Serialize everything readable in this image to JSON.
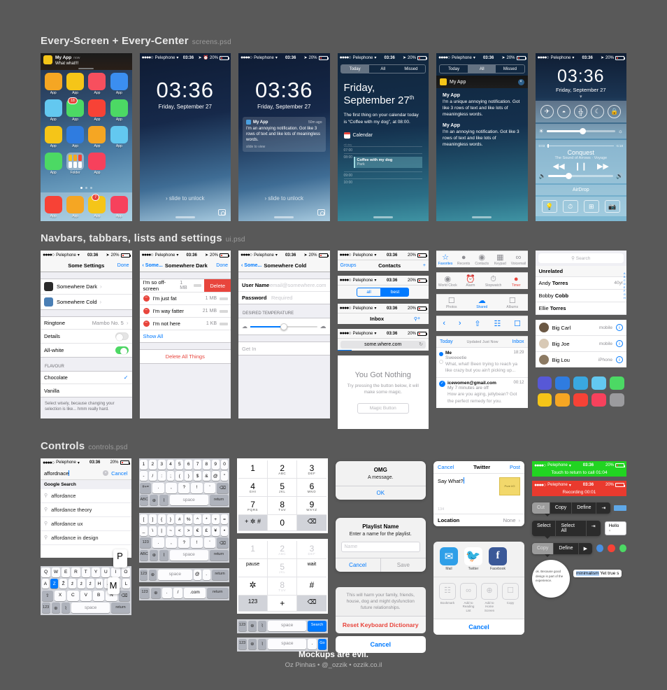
{
  "sections": [
    {
      "title": "Every-Screen + Every-Center",
      "file": "screens.psd"
    },
    {
      "title": "Navbars, tabbars, lists and settings",
      "file": "ui.psd"
    },
    {
      "title": "Controls",
      "file": "controls.psd"
    }
  ],
  "status_bar": {
    "carrier": "Pelephone",
    "time": "03:36",
    "battery": "20%",
    "dots": "●●●●○"
  },
  "home": {
    "banner": {
      "app": "My App",
      "time": "now",
      "message": "What what!!!"
    },
    "app_label": "App",
    "folder_label": "Folder",
    "badges": {
      "grid": "18",
      "dock": "7"
    },
    "rows": [
      [
        "#f5a623",
        "#f5c518",
        "#f74f5e",
        "#3b8ef0"
      ],
      [
        "#63c8f0",
        "#4cd964",
        "#f74236",
        "#4cd964"
      ],
      [
        "#f5c518",
        "#2f7ce0",
        "#f5a623",
        "#63c8f0"
      ],
      [
        "#4cd964",
        "folder",
        "#f7415c",
        ""
      ]
    ],
    "dock": [
      "#f74236",
      "#f5a623",
      "#f5c518",
      "#f7415c"
    ]
  },
  "lock": {
    "time": "03:36",
    "date": "Friday, September 27",
    "slide": "›  slide to unlock",
    "notification": {
      "app": "My App",
      "when": "50m ago",
      "title": "I'm an annoying notification. Got like 3 rows of text and like lots of meaningless words.",
      "hint": "slide to view"
    }
  },
  "notification_center": {
    "tabs": [
      "Today",
      "All",
      "Missed"
    ],
    "today": {
      "active_tab": "Today",
      "heading_line1": "Friday,",
      "heading_line2": "September 27",
      "heading_sup": "th",
      "summary": "The first thing on your calendar today is “Coffee with my dog”, at 08:00.",
      "calendar_label": "Calendar",
      "all_day": "all-day",
      "hours": [
        "07:00",
        "08:00",
        "09:00",
        "10:00"
      ],
      "event_title": "Coffee with my dog",
      "event_place": "Park"
    },
    "all": {
      "active_tab": "All",
      "app_header": "My App",
      "items": [
        {
          "app": "My App",
          "text": "I'm a unique annoying notification. Got like 3 rows of text and like lots of meaningless words."
        },
        {
          "app": "My App",
          "text": "I'm an annoying notification. Got like 3 rows of text and like lots of meaningless words."
        }
      ]
    }
  },
  "control_center": {
    "time": "03:36",
    "date": "Friday, September 27",
    "toggles": [
      "airplane-mode",
      "wifi",
      "bluetooth",
      "do-not-disturb",
      "rotation-lock"
    ],
    "brightness": 52,
    "now_playing": {
      "title": "Conquest",
      "subtitle": "The Sound of Arrows · Voyage",
      "elapsed": "0:03",
      "remaining": "-5:18"
    },
    "volume": 30,
    "airdrop": "AirDrop",
    "quick": [
      "flashlight",
      "timer",
      "calculator",
      "camera"
    ]
  },
  "settings": {
    "title": "Some Settings",
    "done": "Done",
    "rows": [
      {
        "label": "Somewhere Dark",
        "icon": "#2b2b2b"
      },
      {
        "label": "Somewhere Cold",
        "icon": "#4a7fb5"
      }
    ],
    "ringtone": {
      "label": "Ringtone",
      "value": "Mambo No. 5"
    },
    "details": {
      "label": "Details",
      "on": false
    },
    "allwhite": {
      "label": "All-white",
      "on": true
    },
    "flavour_header": "FLAVOUR",
    "flavours": [
      {
        "label": "Chocolate",
        "checked": true
      },
      {
        "label": "Vanilla",
        "checked": false
      }
    ],
    "footer": "Select wisely, because changing your selection is like... hmm really hard."
  },
  "dark": {
    "back": "Some...",
    "title": "Somewhere Dark",
    "done": "Done",
    "swipe_row": {
      "label": "I'm so off-screen",
      "size": "1 MB",
      "delete": "Delete"
    },
    "rows": [
      {
        "label": "I'm just fat",
        "size": "1 MB"
      },
      {
        "label": "I'm way fatter",
        "size": "21 MB"
      },
      {
        "label": "I'm not here",
        "size": "1 KB"
      }
    ],
    "show_all": "Show All",
    "delete_all": "Delete All Things"
  },
  "cold": {
    "back": "Some...",
    "title": "Somewhere Cold",
    "username": {
      "label": "User Name",
      "placeholder": "email@somewhere.com"
    },
    "password": {
      "label": "Password",
      "placeholder": "Required"
    },
    "temp_header": "DESIRED TEMPERATURE",
    "get_in": "Get In"
  },
  "bars": {
    "contacts": {
      "left": "Groups",
      "title": "Contacts",
      "right": "+"
    },
    "segment": {
      "options": [
        "all",
        "best"
      ],
      "selected": "best"
    },
    "inbox": {
      "title": "Inbox",
      "search": "search-icon",
      "add": "+"
    },
    "browser": {
      "url": "some.where.com",
      "reload": "↻"
    },
    "empty": {
      "title": "You Got Nothing",
      "body": "Try pressing the button below, it will make some magic.",
      "button": "Magic Button"
    }
  },
  "tabbars": {
    "phone": [
      {
        "label": "Favorites",
        "icon": "star",
        "on": true
      },
      {
        "label": "Recents",
        "icon": "clock",
        "on": false
      },
      {
        "label": "Contacts",
        "icon": "person",
        "on": false
      },
      {
        "label": "Keypad",
        "icon": "grid",
        "on": false
      },
      {
        "label": "Voicemail",
        "icon": "tape",
        "on": false
      }
    ],
    "clock": [
      {
        "label": "World Clock",
        "icon": "globe",
        "on": false
      },
      {
        "label": "Alarm",
        "icon": "alarm",
        "on": false
      },
      {
        "label": "Stopwatch",
        "icon": "stopwatch",
        "on": false
      },
      {
        "label": "Timer",
        "icon": "timer",
        "red": true
      }
    ],
    "photos": [
      {
        "label": "Photos",
        "icon": "photos",
        "on": false
      },
      {
        "label": "Shared",
        "icon": "cloud",
        "on": true
      },
      {
        "label": "Albums",
        "icon": "albums",
        "on": false
      }
    ],
    "safari": [
      "back",
      "forward",
      "share",
      "bookmarks",
      "tabs"
    ]
  },
  "mail": {
    "header": {
      "left": "Today",
      "middle": "Updated Just Now",
      "right": "Inbox"
    },
    "messages": [
      {
        "from": "Me",
        "time": "18:29",
        "subject": "Sweeeetie",
        "preview": "What, what! Been trying to reach ya like crazy but you ain't picking up...",
        "unread": true,
        "checked": false
      },
      {
        "from": "icewomen@gmail.com",
        "time": "00:12",
        "subject": "My 7 minutes are off",
        "preview": "How are you aging, jellybean? Got the perfect remedy for you.",
        "unread": false,
        "checked": true
      }
    ]
  },
  "contacts": {
    "search_placeholder": "Search",
    "section": "Unrelated",
    "index": [
      "A",
      "B",
      "C",
      "D",
      "E",
      "F",
      "G",
      "H"
    ],
    "people": [
      {
        "name_first": "Andy",
        "name_last": "Torres",
        "meta": "40yr"
      },
      {
        "name_first": "Bobby",
        "name_last": "Cobb",
        "meta": ""
      },
      {
        "name_first": "Ellie",
        "name_last": "Torres",
        "meta": ""
      }
    ],
    "calls": [
      {
        "name": "Big Carl",
        "kind": "mobile"
      },
      {
        "name": "Big Joe",
        "kind": "mobile"
      },
      {
        "name": "Big Lou",
        "kind": "iPhone"
      }
    ],
    "swatches": [
      "#5758d6",
      "#2f7ce0",
      "#3aa8e0",
      "#63c8f0",
      "#4cd964",
      "#f5c518",
      "#f5a623",
      "#f74236",
      "#f7415c",
      "#9b9b9e"
    ]
  },
  "controls": {
    "search": {
      "value": "affordnace",
      "cancel": "Cancel",
      "group": "Google Search",
      "suggestions": [
        "affordance",
        "affordance theory",
        "affordance ux",
        "affordance in design"
      ]
    },
    "keyboard_letters": {
      "row1": [
        "Q",
        "W",
        "E",
        "R",
        "T",
        "Y",
        "U",
        "I",
        "O",
        "P"
      ],
      "row2": [
        "A",
        "Z",
        "Ž",
        "ź",
        "ż",
        "ź",
        "H",
        "J",
        "K",
        "L"
      ],
      "row3": [
        "X",
        "C",
        "V",
        "B",
        "N",
        "M"
      ],
      "shift": "⇧",
      "backspace": "⌫",
      "num": "123",
      "globe": "⊕",
      "mic": "⌇",
      "space": "space",
      "return": "return",
      "popup": "P",
      "selected_key": "Z",
      "big_key": "M"
    },
    "keyboard_numbers": {
      "row1": [
        "1",
        "2",
        "3",
        "4",
        "5",
        "6",
        "7",
        "8",
        "9",
        "0"
      ],
      "row2": [
        "-",
        "/",
        ":",
        ";",
        "(",
        ")",
        "$",
        "&",
        "@",
        "\""
      ],
      "row3": [
        "#+=",
        ".",
        ",",
        "?",
        "!",
        "'",
        "⌫"
      ],
      "row4": [
        "ABC",
        "⊕",
        "⌇",
        "space",
        "return"
      ]
    },
    "keyboard_symbols": {
      "row1": [
        "[",
        "]",
        "{",
        "}",
        "#",
        "%",
        "^",
        "*",
        "+",
        "="
      ],
      "row2": [
        "_",
        "\\",
        "|",
        "~",
        "<",
        ">",
        "€",
        "£",
        "¥",
        "•"
      ],
      "row3": [
        "123",
        ".",
        ",",
        "?",
        "!",
        "'",
        "⌫"
      ],
      "row4": [
        "ABC",
        "⊕",
        "⌇",
        "space",
        "return"
      ]
    },
    "bottom_rows": [
      [
        "123",
        "⊕",
        "space",
        "@",
        ".",
        "return"
      ],
      [
        "123",
        "⊕",
        ".",
        "/",
        ".com",
        "return"
      ],
      [
        "123",
        "⊕",
        "⌇",
        "space",
        "Search"
      ],
      [
        "123",
        "⊕",
        "⌇",
        "space",
        ".",
        "Go"
      ]
    ],
    "keypad": {
      "keys": [
        {
          "d": "1",
          "s": ""
        },
        {
          "d": "2",
          "s": "ABC"
        },
        {
          "d": "3",
          "s": "DEF"
        },
        {
          "d": "4",
          "s": "GHI"
        },
        {
          "d": "5",
          "s": "JKL"
        },
        {
          "d": "6",
          "s": "MNO"
        },
        {
          "d": "7",
          "s": "PQRS"
        },
        {
          "d": "8",
          "s": "TUV"
        },
        {
          "d": "9",
          "s": "WXYZ"
        },
        {
          "d": "+ ✲ #",
          "s": ""
        },
        {
          "d": "0",
          "s": ""
        },
        {
          "d": "⌫",
          "s": ""
        }
      ],
      "dtmf": [
        {
          "d": "1",
          "s": "",
          "dim": true
        },
        {
          "d": "2",
          "s": "ABC",
          "dim": true
        },
        {
          "d": "3",
          "s": "DEF",
          "dim": true
        },
        {
          "d": "pause",
          "s": ""
        },
        {
          "d": "5",
          "s": "JKL",
          "dim": true
        },
        {
          "d": "wait",
          "s": ""
        },
        {
          "d": "✲",
          "s": ""
        },
        {
          "d": "8",
          "s": "TUV",
          "dim": true
        },
        {
          "d": "#",
          "s": ""
        },
        {
          "d": "123",
          "s": ""
        },
        {
          "d": "+",
          "s": ""
        },
        {
          "d": "⌫",
          "s": ""
        }
      ]
    },
    "alert_simple": {
      "title": "OMG",
      "message": "A message.",
      "ok": "OK"
    },
    "alert_input": {
      "title": "Playlist Name",
      "message": "Enter a name for the playlist.",
      "placeholder": "Name",
      "cancel": "Cancel",
      "save": "Save"
    },
    "action_sheet": {
      "warning": "This will harm your family, friends, house, dog and might dysfunction future relationships.",
      "destructive": "Reset Keyboard Dictionary",
      "cancel": "Cancel"
    },
    "tweet": {
      "cancel": "Cancel",
      "title": "Twitter",
      "post": "Post",
      "text": "Say What?",
      "count": "134",
      "location_label": "Location",
      "location_value": "None",
      "thumb": "Pure I/O"
    },
    "share": {
      "apps": [
        {
          "label": "Mail",
          "color": "#2f9fe8",
          "glyph": "✉"
        },
        {
          "label": "Twitter",
          "color": "#ffffff",
          "glyph": "🐦"
        },
        {
          "label": "Facebook",
          "color": "#3b5998",
          "glyph": "f"
        }
      ],
      "actions": [
        "Bookmark",
        "Add to Reading List",
        "Add to Home Screen",
        "Copy"
      ],
      "cancel": "Cancel"
    },
    "call_bar": {
      "text": "Touch to return to call  01:04",
      "color": "#21d421"
    },
    "record_bar": {
      "text": "Recording  00:01",
      "color": "#ea3a2e"
    },
    "menu_1": [
      "Cut",
      "Copy",
      "Define",
      "⇥"
    ],
    "menu_2": [
      "Select",
      "Select All",
      "⇥"
    ],
    "menu_3": [
      "Copy",
      "Define",
      "▶"
    ],
    "tooltip_hello": "Hello",
    "magnifier": "ok. Because good design is part of the experience.",
    "selection": {
      "highlight": "minimalism",
      "rest": "Yet true s"
    }
  },
  "footer": {
    "line1": "Mockups are evil.",
    "line2": "Oz Pinhas • @_ozzik • ozzik.co.il"
  }
}
